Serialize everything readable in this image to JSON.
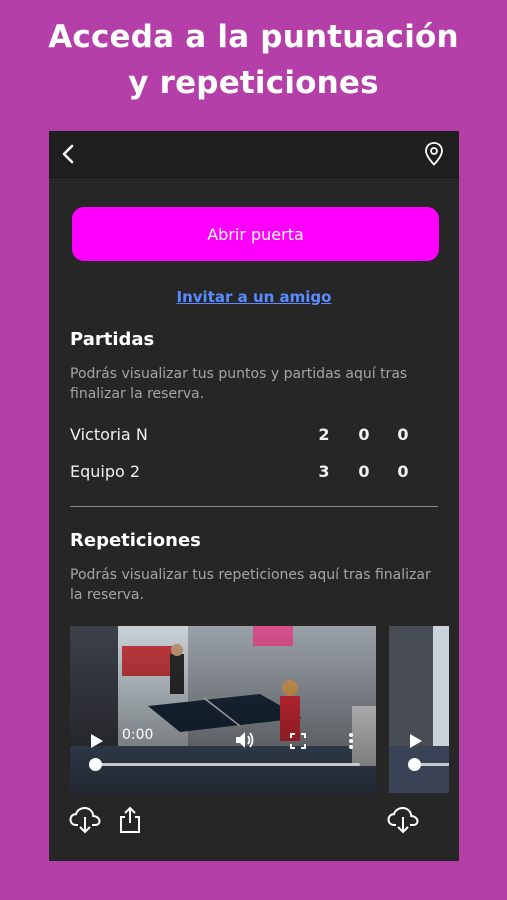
{
  "headline": {
    "line1": "Acceda a la puntuación",
    "line2": "y repeticiones"
  },
  "topbar": {
    "back_icon": "chevron-left-icon",
    "location_icon": "map-pin-icon"
  },
  "open_door_label": "Abrir puerta",
  "invite_link": "Invitar a un amigo",
  "matches": {
    "title": "Partidas",
    "description": "Podrás visualizar tus puntos y partidas aquí tras finalizar la reserva.",
    "rows": [
      {
        "name": "Victoria N",
        "scores": [
          "2",
          "0",
          "0"
        ]
      },
      {
        "name": "Equipo 2",
        "scores": [
          "3",
          "0",
          "0"
        ]
      }
    ]
  },
  "replays": {
    "title": "Repeticiones",
    "description": "Podrás visualizar tus repeticiones aquí tras finalizar la reserva.",
    "video1": {
      "time": "0:00",
      "progress": 0
    },
    "video2": {
      "progress": 0
    }
  },
  "colors": {
    "background": "#b53fa8",
    "panel": "#262626",
    "accent": "#ff00ff",
    "link": "#5a8cff"
  }
}
